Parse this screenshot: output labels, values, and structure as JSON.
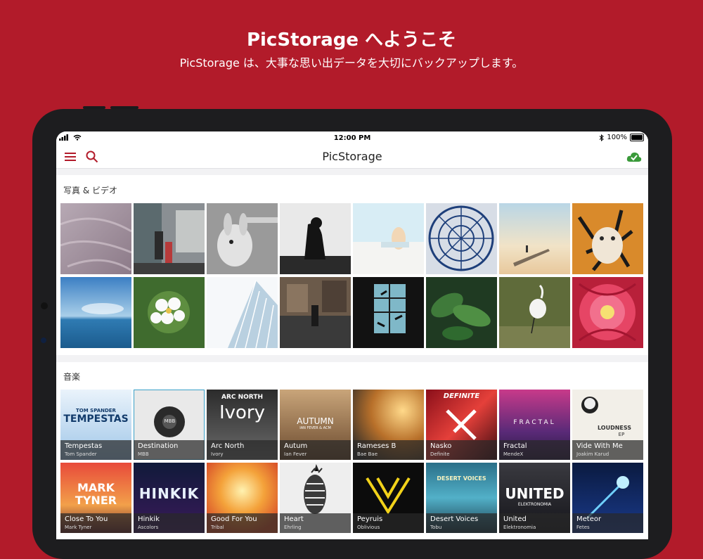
{
  "promo": {
    "title": "PicStorage へようこそ",
    "subtitle": "PicStorage は、大事な思い出データを大切にバックアップします。"
  },
  "status_bar": {
    "time": "12:00 PM",
    "battery": "100%",
    "battery_level": 1.0
  },
  "nav": {
    "title": "PicStorage",
    "menu_icon": "hamburger-icon",
    "search_icon": "search-icon",
    "sync_icon": "cloud-check-icon"
  },
  "photos_section": {
    "label": "写真 & ビデオ"
  },
  "music_section": {
    "label": "音楽",
    "albums": [
      {
        "title": "Tempestas",
        "artist": "Tom Spander",
        "cover_line1": "TOM SPANDER",
        "cover_line2": "TEMPESTAS"
      },
      {
        "title": "Destination",
        "artist": "MBB",
        "cover_line1": "MBB"
      },
      {
        "title": "Arc North",
        "artist": "Ivory",
        "cover_line1": "ARC NORTH",
        "cover_line2": "Ivory"
      },
      {
        "title": "Autum",
        "artist": "Ian Fever",
        "cover_line1": "AUTUMN",
        "cover_line2": "IAN FEVER & ACM"
      },
      {
        "title": "Rameses B",
        "artist": "Bae Bae"
      },
      {
        "title": "Nasko",
        "artist": "Definite",
        "cover_line1": "DEFINITE"
      },
      {
        "title": "Fractal",
        "artist": "MendeX",
        "cover_line1": "FRACTAL"
      },
      {
        "title": "Vide With Me",
        "artist": "Joakim Karud",
        "cover_line1": "LOUDNESS",
        "cover_line2": "EP"
      },
      {
        "title": "Close To You",
        "artist": "Mark Tyner",
        "cover_line1": "MARK",
        "cover_line2": "TYNER"
      },
      {
        "title": "Hinkik",
        "artist": "Ascolors",
        "cover_line1": "HINKIK"
      },
      {
        "title": "Good For You",
        "artist": "Tribal"
      },
      {
        "title": "Heart",
        "artist": "Ehrling"
      },
      {
        "title": "Peyruis",
        "artist": "Oblivious"
      },
      {
        "title": "Desert Voices",
        "artist": "Tobu",
        "cover_line1": "DESERT VOICES"
      },
      {
        "title": "United",
        "artist": "Elektronomia",
        "cover_line1": "UNITED",
        "cover_line2": "ELEKTRONOMIA"
      },
      {
        "title": "Meteor",
        "artist": "Fetes"
      }
    ]
  },
  "colors": {
    "brand": "#b21b2a",
    "accent_green": "#3a9a3a"
  }
}
